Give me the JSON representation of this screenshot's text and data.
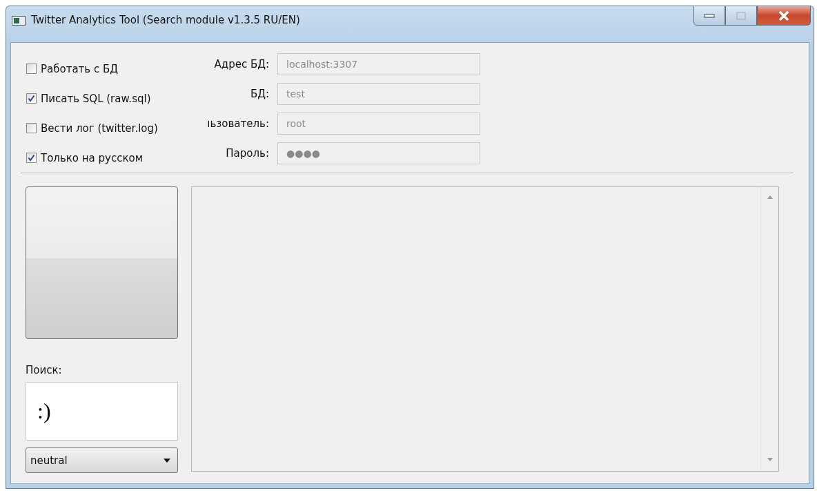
{
  "window": {
    "title": "Twitter Analytics Tool (Search module v1.3.5 RU/EN)"
  },
  "options": [
    {
      "label": "Работать с БД",
      "checked": false
    },
    {
      "label": "Писать SQL (raw.sql)",
      "checked": true
    },
    {
      "label": "Вести лог (twitter.log)",
      "checked": false
    },
    {
      "label": "Только на русском",
      "checked": true
    }
  ],
  "db_fields": [
    {
      "label": "Адрес БД:",
      "value": "localhost:3307",
      "disabled": true
    },
    {
      "label": "БД:",
      "value": "test",
      "disabled": true
    },
    {
      "label": "ıьзователь:",
      "value": "root",
      "disabled": true
    },
    {
      "label": "Пароль:",
      "value": "●●●●",
      "disabled": true
    }
  ],
  "search": {
    "label": "Поиск:",
    "value": ":)"
  },
  "mood_select": {
    "value": "neutral"
  }
}
